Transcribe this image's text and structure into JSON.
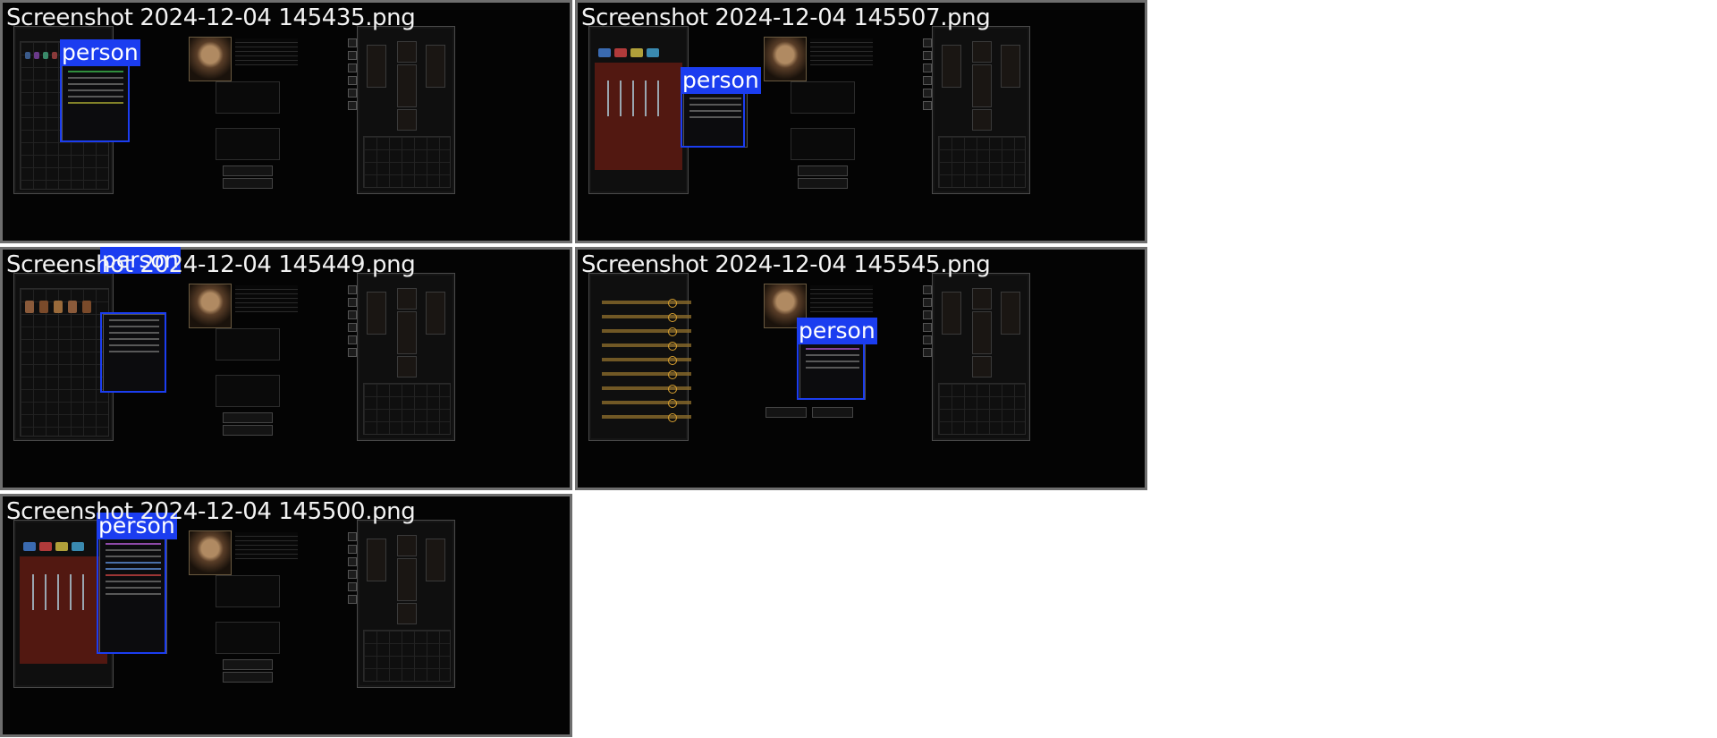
{
  "screenshots": [
    {
      "title": "Screenshot 2024-12-04 145435.png",
      "label": "person",
      "variant": "gems"
    },
    {
      "title": "Screenshot 2024-12-04 145507.png",
      "label": "person",
      "variant": "weapons"
    },
    {
      "title": "Screenshot 2024-12-04 145449.png",
      "label": "person",
      "variant": "shields"
    },
    {
      "title": "Screenshot 2024-12-04 145545.png",
      "label": "person",
      "variant": "list"
    },
    {
      "title": "Screenshot 2024-12-04 145500.png",
      "label": "person",
      "variant": "weapons"
    }
  ],
  "colors": {
    "tile_border": "#6e6e6e",
    "detection_box": "#1b3df0",
    "label_text": "#ffffff",
    "game_bg": "#040404"
  }
}
